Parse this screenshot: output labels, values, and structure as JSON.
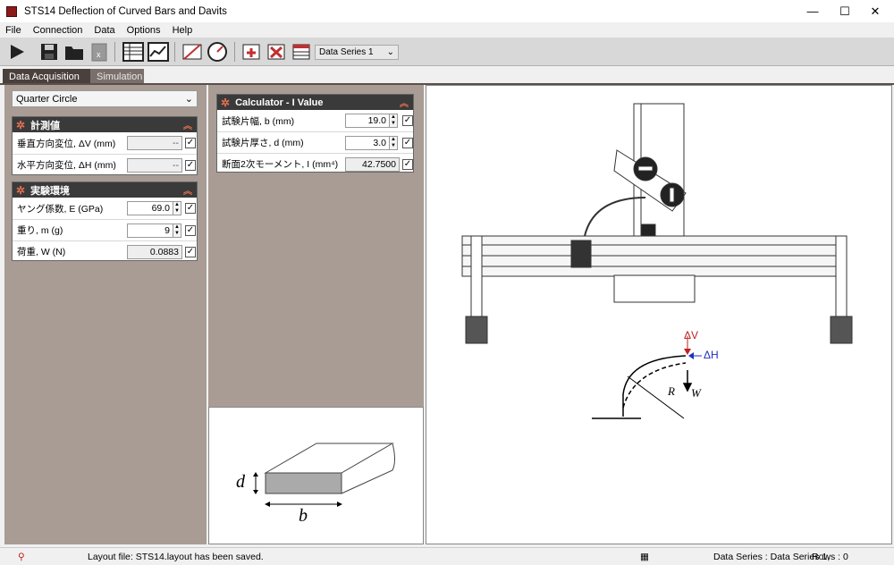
{
  "window": {
    "title": "STS14 Deflection of Curved Bars and Davits",
    "minimize": "—",
    "maximize": "☐",
    "close": "✕"
  },
  "menu": [
    "File",
    "Connection",
    "Data",
    "Options",
    "Help"
  ],
  "toolbar": {
    "series_selected": "Data Series 1"
  },
  "tabs": [
    "Data Acquisition",
    "Simulation"
  ],
  "sim": {
    "shape": "Quarter Circle",
    "measured": {
      "title": "計測値",
      "rows": [
        {
          "label": "垂直方向変位, ΔV (mm)",
          "value": "--"
        },
        {
          "label": "水平方向変位, ΔH (mm)",
          "value": "--"
        }
      ]
    },
    "env": {
      "title": "実験環境",
      "rows": [
        {
          "label": "ヤング係数, E (GPa)",
          "value": "69.0"
        },
        {
          "label": "重り, m (g)",
          "value": "9"
        },
        {
          "label": "荷重, W (N)",
          "value": "0.0883"
        }
      ]
    },
    "calc": {
      "title": "Calculator - I Value",
      "rows": [
        {
          "label": "試験片幅, b (mm)",
          "value": "19.0"
        },
        {
          "label": "試験片厚さ, d (mm)",
          "value": "3.0"
        },
        {
          "label": "断面2次モーメント, I (mm⁴)",
          "value": "42.7500"
        }
      ]
    },
    "diagram": {
      "d": "d",
      "b": "b",
      "delta_v": "ΔV",
      "delta_h": "ΔH",
      "R": "R",
      "W": "W"
    }
  },
  "status": {
    "layout_msg": "Layout file: STS14.layout has been saved.",
    "series": "Data Series : Data Series 1,",
    "rows": "Rows : 0"
  },
  "colors": {
    "panel": "#a89c94",
    "header": "#3a3a3a",
    "accent": "#e07050",
    "tab": "#5a4f4a"
  }
}
